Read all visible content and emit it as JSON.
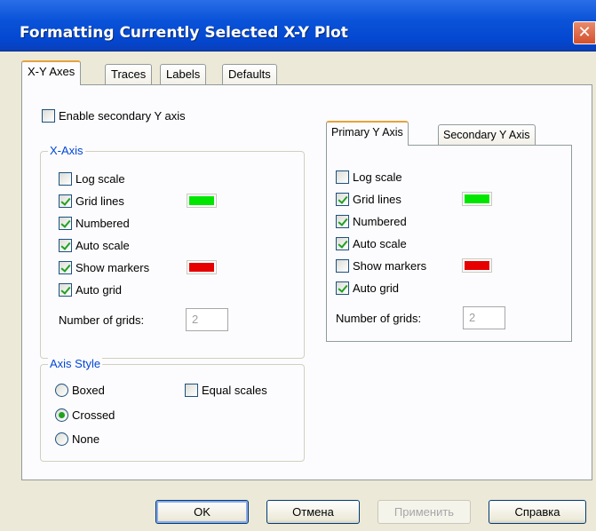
{
  "window": {
    "title": "Formatting Currently Selected X-Y Plot",
    "close_glyph": "✕"
  },
  "tabs": [
    "X-Y Axes",
    "Traces",
    "Labels",
    "Defaults"
  ],
  "enable_secondary": {
    "label": "Enable secondary Y axis",
    "checked": false
  },
  "x_axis": {
    "title": "X-Axis",
    "options": {
      "log_scale": {
        "label": "Log scale",
        "checked": false
      },
      "grid_lines": {
        "label": "Grid lines",
        "checked": true,
        "color": "#00e600"
      },
      "numbered": {
        "label": "Numbered",
        "checked": true
      },
      "auto_scale": {
        "label": "Auto scale",
        "checked": true
      },
      "show_markers": {
        "label": "Show markers",
        "checked": true,
        "color": "#e60000"
      },
      "auto_grid": {
        "label": "Auto grid",
        "checked": true
      }
    },
    "num_grids_label": "Number of grids:",
    "num_grids_value": "2"
  },
  "y_tabs": [
    "Primary Y Axis",
    "Secondary Y Axis"
  ],
  "y_axis": {
    "options": {
      "log_scale": {
        "label": "Log scale",
        "checked": false
      },
      "grid_lines": {
        "label": "Grid lines",
        "checked": true,
        "color": "#00e600"
      },
      "numbered": {
        "label": "Numbered",
        "checked": true
      },
      "auto_scale": {
        "label": "Auto scale",
        "checked": true
      },
      "show_markers": {
        "label": "Show markers",
        "checked": false,
        "color": "#e60000"
      },
      "auto_grid": {
        "label": "Auto grid",
        "checked": true
      }
    },
    "num_grids_label": "Number of grids:",
    "num_grids_value": "2"
  },
  "axis_style": {
    "title": "Axis Style",
    "radios": [
      {
        "label": "Boxed",
        "checked": false
      },
      {
        "label": "Crossed",
        "checked": true
      },
      {
        "label": "None",
        "checked": false
      }
    ],
    "equal_scales": {
      "label": "Equal scales",
      "checked": false
    }
  },
  "buttons": {
    "ok": "OK",
    "cancel": "Отмена",
    "apply": "Применить",
    "help": "Справка"
  }
}
